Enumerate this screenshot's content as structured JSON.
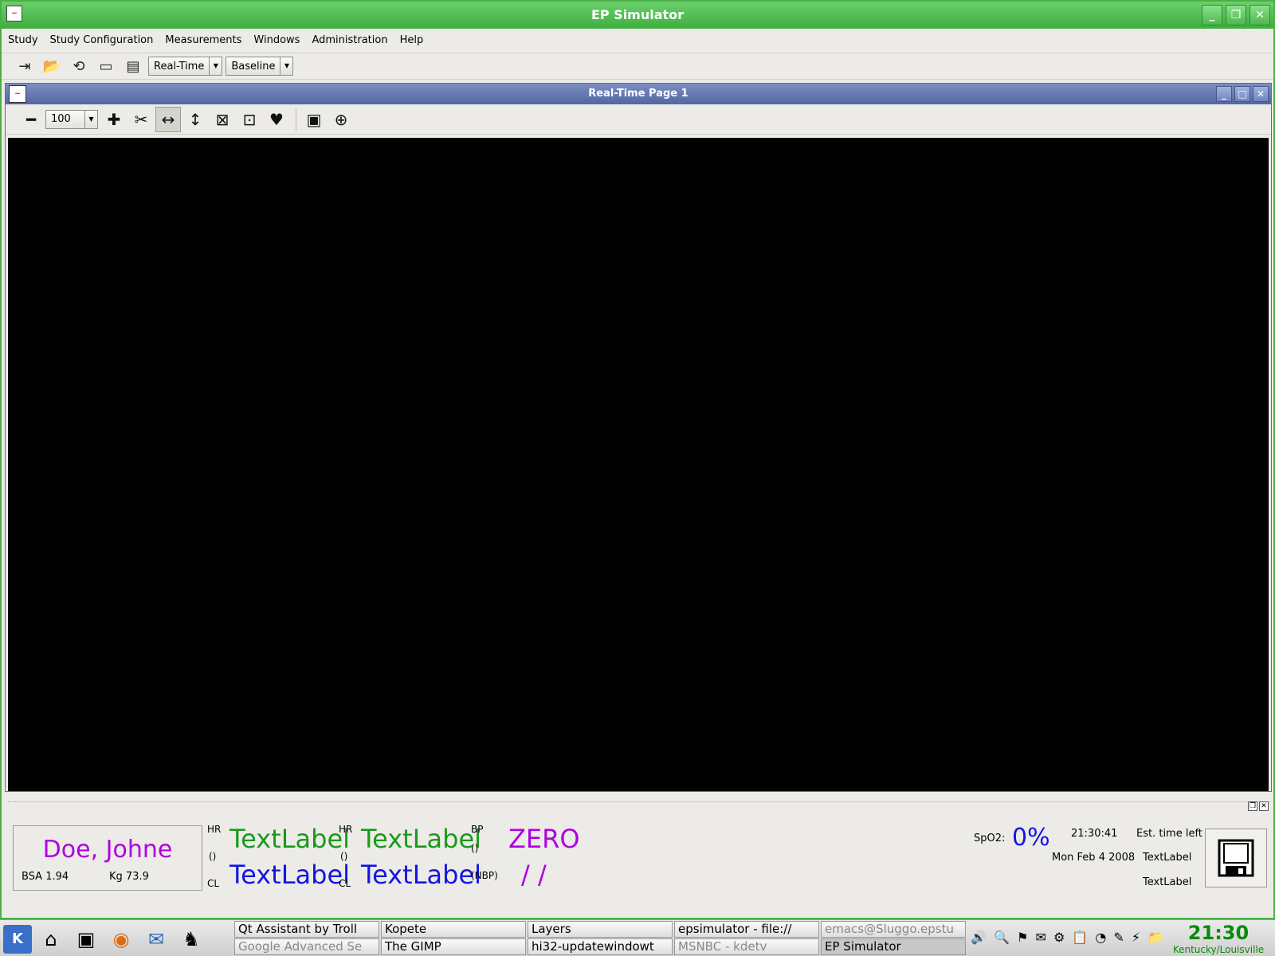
{
  "window": {
    "title": "EP Simulator"
  },
  "menu": [
    "Study",
    "Study Configuration",
    "Measurements",
    "Windows",
    "Administration",
    "Help"
  ],
  "toolbar": {
    "mode": "Real-Time",
    "protocol": "Baseline"
  },
  "subwindow": {
    "title": "Real-Time Page 1",
    "zoom": "100"
  },
  "patient": {
    "name": "Doe, Johne",
    "bsa": "BSA 1.94",
    "kg": "Kg 73.9"
  },
  "vitals": {
    "hr1_label": "HR",
    "hr1_unit": "()",
    "cl1_label": "CL",
    "hr1_value": "TextLabel",
    "cl1_value": "TextLabel",
    "hr2_label": "HR",
    "hr2_unit": "()",
    "cl2_label": "CL",
    "hr2_value": "TextLabel",
    "cl2_value": "TextLabel",
    "bp_label": "BP",
    "bp_unit": "()",
    "nbp_label": "(NBP)",
    "bp_value": "ZERO",
    "nbp_value": "/ /",
    "spo2_label": "SpO2:",
    "spo2_value": "0%"
  },
  "status": {
    "time": "21:30:41",
    "date": "Mon Feb 4 2008",
    "est_label": "Est. time left",
    "text1": "TextLabel",
    "text2": "TextLabel"
  },
  "taskbar": {
    "tasks_top": [
      "Qt Assistant by Troll",
      "Kopete",
      "Layers",
      "epsimulator - file://",
      "emacs@Sluggo.epstu"
    ],
    "tasks_bottom": [
      "Google Advanced Se",
      "The GIMP",
      "hi32-updatewindowt",
      "MSNBC - kdetv",
      "EP Simulator"
    ],
    "clock_time": "21:30",
    "clock_zone": "Kentucky/Louisville"
  },
  "colors": {
    "title_green": "#3fae3f",
    "sub_blue": "#5266a0",
    "name_purple": "#b000e0",
    "value_green": "#1a9a1a",
    "value_blue": "#1515e0"
  }
}
